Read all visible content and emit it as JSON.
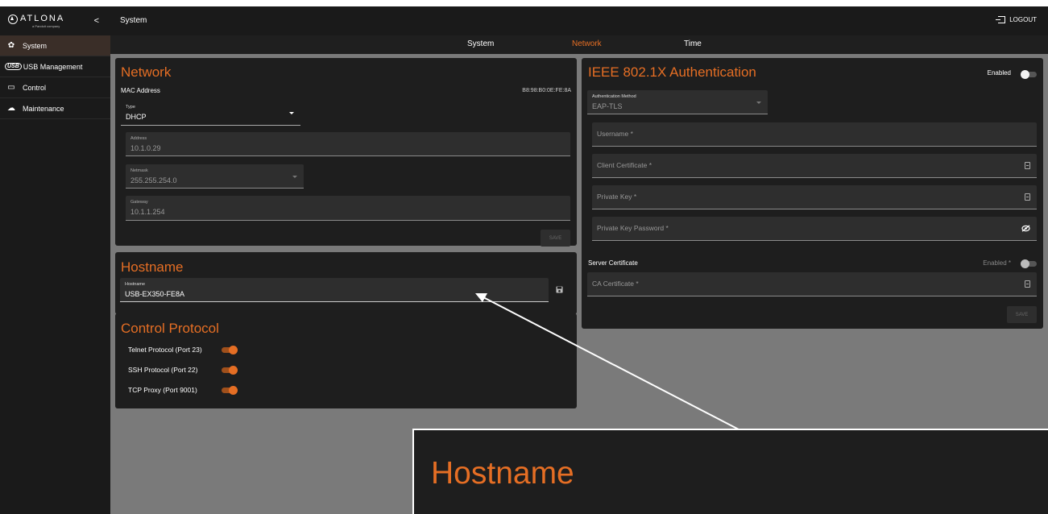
{
  "brand": {
    "name": "ATLONA",
    "tagline": "a Panduit company",
    "collapse": "<"
  },
  "sidebar": {
    "items": [
      {
        "label": "System",
        "icon": "gear-icon"
      },
      {
        "label": "USB Management",
        "badge": "USB",
        "icon": "usb-icon"
      },
      {
        "label": "Control",
        "icon": "monitor-icon"
      },
      {
        "label": "Maintenance",
        "icon": "cloud-check-icon"
      }
    ]
  },
  "header": {
    "title": "System",
    "logout_label": "LOGOUT"
  },
  "tabs": [
    "System",
    "Network",
    "Time"
  ],
  "network": {
    "title": "Network",
    "mac_label": "MAC Address",
    "mac_value": "B8:98:B0:0E:FE:8A",
    "type_label": "Type",
    "type_value": "DHCP",
    "address_label": "Address",
    "address_value": "10.1.0.29",
    "netmask_label": "Netmask",
    "netmask_value": "255.255.254.0",
    "gateway_label": "Gateway",
    "gateway_value": "10.1.1.254",
    "save_label": "SAVE"
  },
  "hostname": {
    "title": "Hostname",
    "field_label": "Hostname",
    "field_value": "USB-EX350-FE8A"
  },
  "control_protocol": {
    "title": "Control Protocol",
    "items": [
      {
        "label": "Telnet Protocol (Port 23)",
        "enabled": true
      },
      {
        "label": "SSH Protocol (Port 22)",
        "enabled": true
      },
      {
        "label": "TCP Proxy (Port 9001)",
        "enabled": true
      }
    ]
  },
  "ieee": {
    "title": "IEEE 802.1X Authentication",
    "enabled_label": "Enabled",
    "auth_method_label": "Authentication Method",
    "auth_method_value": "EAP-TLS",
    "username_placeholder": "Username *",
    "client_cert_placeholder": "Client Certificate *",
    "private_key_placeholder": "Private Key *",
    "private_key_password_placeholder": "Private Key Password *",
    "server_cert_label": "Server Certificate",
    "server_cert_enabled_label": "Enabled *",
    "ca_cert_placeholder": "CA Certificate *",
    "save_label": "SAVE"
  },
  "callout": {
    "title": "Hostname"
  },
  "colors": {
    "accent": "#e56e24",
    "panel": "#1e1e1e",
    "background": "#7a7a7a"
  }
}
